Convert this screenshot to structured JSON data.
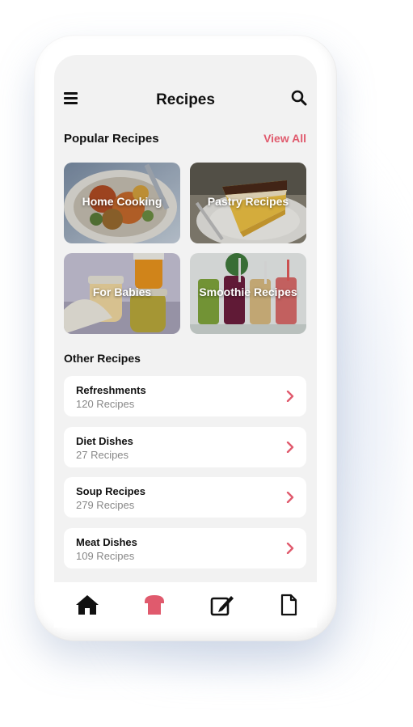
{
  "header": {
    "title": "Recipes",
    "menu_icon": "hamburger-menu-icon",
    "search_icon": "search-icon"
  },
  "popular": {
    "title": "Popular Recipes",
    "view_all": "View All",
    "tiles": [
      {
        "label": "Home Cooking"
      },
      {
        "label": "Pastry Recipes"
      },
      {
        "label": "For Babies"
      },
      {
        "label": "Smoothie Recipes"
      }
    ]
  },
  "other": {
    "title": "Other Recipes",
    "items": [
      {
        "name": "Refreshments",
        "count": "120 Recipes"
      },
      {
        "name": "Diet Dishes",
        "count": "27 Recipes"
      },
      {
        "name": "Soup Recipes",
        "count": "279 Recipes"
      },
      {
        "name": "Meat Dishes",
        "count": "109 Recipes"
      }
    ]
  },
  "tabbar": {
    "tabs": [
      {
        "icon": "home-icon",
        "active": false
      },
      {
        "icon": "chef-hat-icon",
        "active": true
      },
      {
        "icon": "edit-icon",
        "active": false
      },
      {
        "icon": "document-icon",
        "active": false
      }
    ]
  },
  "colors": {
    "accent": "#e05a6d",
    "screen_bg": "#f2f2f2",
    "card_bg": "#ffffff",
    "text": "#111111",
    "muted": "#888888"
  }
}
